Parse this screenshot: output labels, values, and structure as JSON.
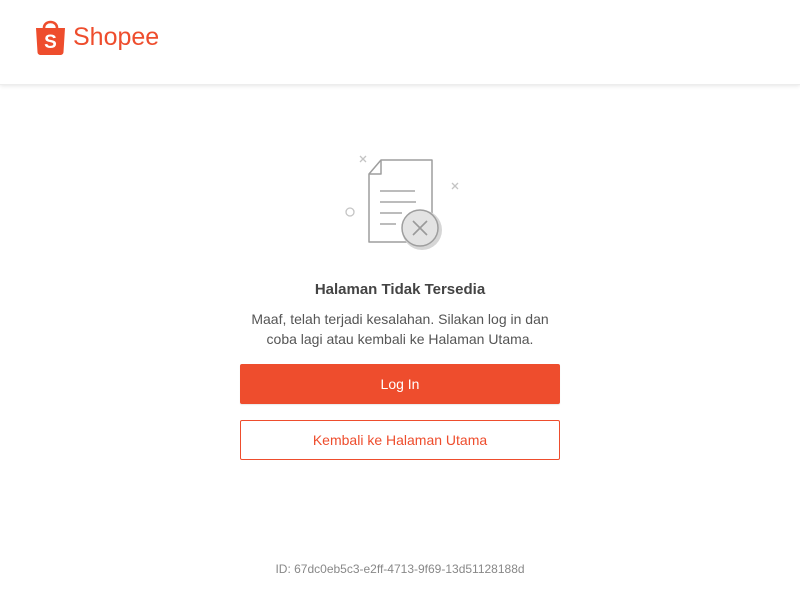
{
  "brand": {
    "name": "Shopee",
    "color": "#ee4d2d",
    "logo_icon": "shopping-bag-icon"
  },
  "error_page": {
    "illustration_icon": "document-error-icon",
    "title": "Halaman Tidak Tersedia",
    "message": "Maaf, telah terjadi kesalahan. Silakan log in dan coba lagi atau kembali ke Halaman Utama.",
    "login_button_label": "Log In",
    "home_button_label": "Kembali ke Halaman Utama",
    "request_id": "ID: 67dc0eb5c3-e2ff-4713-9f69-13d51128188d"
  }
}
